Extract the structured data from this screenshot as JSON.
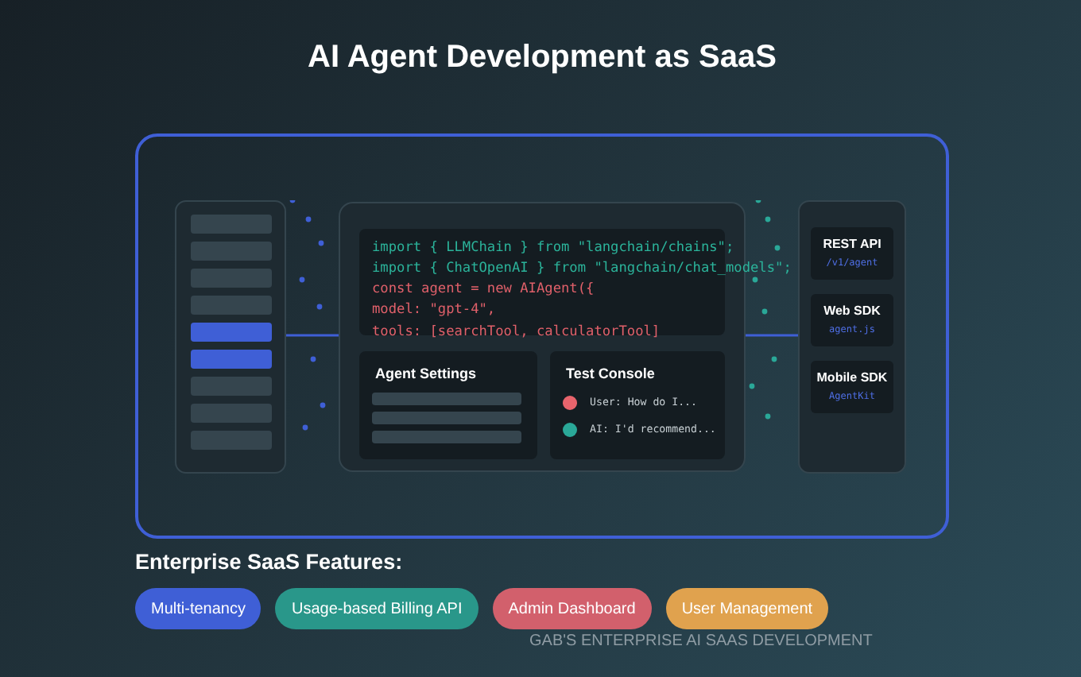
{
  "title": "AI Agent Development as SaaS",
  "sidebar": {
    "items": [
      {
        "selected": false
      },
      {
        "selected": false
      },
      {
        "selected": false
      },
      {
        "selected": false
      },
      {
        "selected": true
      },
      {
        "selected": true
      },
      {
        "selected": false
      },
      {
        "selected": false
      },
      {
        "selected": false
      }
    ]
  },
  "code": {
    "lines": [
      {
        "text": "import { LLMChain } from \"langchain/chains\";",
        "color": "#2bb39a"
      },
      {
        "text": "import { ChatOpenAI } from \"langchain/chat_models\";",
        "color": "#2bb39a"
      },
      {
        "text": "const agent = new AIAgent({",
        "color": "#e0606a"
      },
      {
        "text": "model: \"gpt-4\",",
        "color": "#e0606a"
      },
      {
        "text": "tools: [searchTool, calculatorTool]",
        "color": "#e0606a"
      }
    ]
  },
  "agent_settings": {
    "title": "Agent Settings"
  },
  "test_console": {
    "title": "Test Console",
    "messages": [
      {
        "text": "User: How do I...",
        "color": "#e8646c"
      },
      {
        "text": "AI: I'd recommend...",
        "color": "#2aa898"
      }
    ]
  },
  "endpoints": [
    {
      "name": "REST API",
      "detail": "/v1/agent"
    },
    {
      "name": "Web SDK",
      "detail": "agent.js"
    },
    {
      "name": "Mobile SDK",
      "detail": "AgentKit"
    }
  ],
  "features": {
    "heading": "Enterprise SaaS Features:",
    "items": [
      {
        "label": "Multi-tenancy",
        "color": "#3f5fd6"
      },
      {
        "label": "Usage-based Billing API",
        "color": "#29978a"
      },
      {
        "label": "Admin Dashboard",
        "color": "#d2606c"
      },
      {
        "label": "User Management",
        "color": "#e0a24e"
      }
    ]
  },
  "footer": "GAB'S ENTERPRISE AI SAAS DEVELOPMENT"
}
